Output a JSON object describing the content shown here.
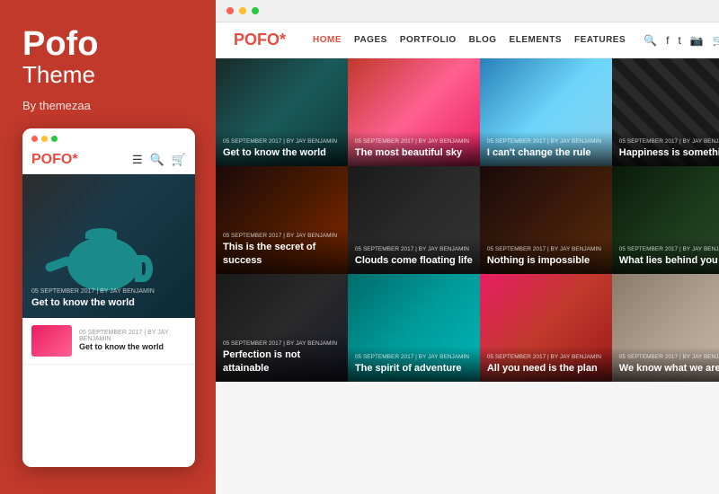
{
  "sidebar": {
    "brand_title": "Pofo",
    "brand_subtitle": "Theme",
    "by_text": "By themezaa"
  },
  "mobile_preview": {
    "logo": "POFO",
    "logo_star": "*",
    "hero_meta": "05 SEPTEMBER 2017  |  BY JAY BENJAMIN",
    "hero_title": "Get to know the world",
    "list_meta": "05 SEPTEMBER 2017  |  BY JAY BENJAMIN",
    "list_title": "Get to know the world"
  },
  "desktop_nav": {
    "logo": "POFO",
    "logo_star": "*",
    "items": [
      {
        "label": "HOME",
        "active": true
      },
      {
        "label": "PAGES",
        "active": false
      },
      {
        "label": "PORTFOLIO",
        "active": false
      },
      {
        "label": "BLOG",
        "active": false
      },
      {
        "label": "ELEMENTS",
        "active": false
      },
      {
        "label": "FEATURES",
        "active": false
      }
    ]
  },
  "grid": {
    "meta_text": "05 SEPTEMBER 2017  |  BY JAY BENJAMIN",
    "items": [
      {
        "title": "Get to know the world",
        "bg": "bg-teapot"
      },
      {
        "title": "The most beautiful sky",
        "bg": "bg-pink"
      },
      {
        "title": "I can't change the rule",
        "bg": "bg-blue"
      },
      {
        "title": "Happiness is something",
        "bg": "bg-striped"
      },
      {
        "title": "This is the secret of success",
        "bg": "bg-peppers"
      },
      {
        "title": "Clouds come floating life",
        "bg": "bg-dark-rings"
      },
      {
        "title": "Nothing is impossible",
        "bg": "bg-cocktail"
      },
      {
        "title": "What lies behind you",
        "bg": "bg-green-leaf"
      },
      {
        "title": "Perfection is not attainable",
        "bg": "bg-portrait"
      },
      {
        "title": "The spirit of adventure",
        "bg": "bg-balloons"
      },
      {
        "title": "All you need is the plan",
        "bg": "bg-plan"
      },
      {
        "title": "We know what we are",
        "bg": "bg-glasses"
      }
    ]
  }
}
